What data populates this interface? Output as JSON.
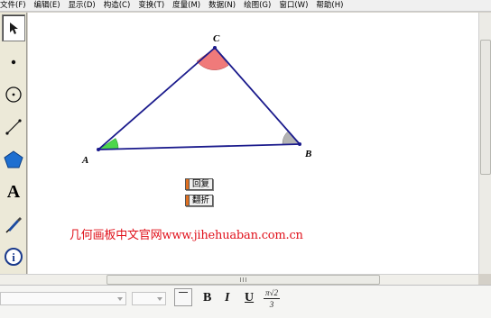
{
  "menubar": {
    "items": [
      "文件(F)",
      "编辑(E)",
      "显示(D)",
      "构造(C)",
      "变换(T)",
      "度量(M)",
      "数据(N)",
      "绘图(G)",
      "窗口(W)",
      "帮助(H)"
    ]
  },
  "toolbox": {
    "tools": [
      {
        "name": "arrow-select-tool",
        "icon": "arrow-icon",
        "selected": true
      },
      {
        "name": "point-tool",
        "icon": "point-icon"
      },
      {
        "name": "compass-tool",
        "icon": "circle-icon"
      },
      {
        "name": "straightedge-tool",
        "icon": "segment-icon"
      },
      {
        "name": "polygon-tool",
        "icon": "polygon-icon"
      },
      {
        "name": "text-tool",
        "icon": "text-a-icon",
        "label": "A"
      },
      {
        "name": "marker-tool",
        "icon": "marker-pen-icon"
      },
      {
        "name": "information-tool",
        "icon": "info-icon",
        "label": "i"
      },
      {
        "name": "custom-tool",
        "icon": "custom-tool-icon"
      }
    ]
  },
  "sketch": {
    "points": {
      "A": "A",
      "B": "B",
      "C": "C"
    },
    "angle_marks": {
      "A": "#4cd64c",
      "B": "#b4b4b4",
      "C": "#f07a7a"
    },
    "triangle_color": "#1a1a8c",
    "buttons": {
      "restore": "回复",
      "fold": "翻折"
    },
    "watermark": "几何画板中文官网www.jihehuaban.com.cn"
  },
  "text_toolbar": {
    "font_family_value": "",
    "font_size_value": "",
    "bold": "B",
    "italic": "I",
    "underline": "U",
    "symbol_top": "π√2",
    "symbol_bottom": "3"
  },
  "colors": {
    "watermark": "#e0101a",
    "button_marker": "#e07020"
  }
}
